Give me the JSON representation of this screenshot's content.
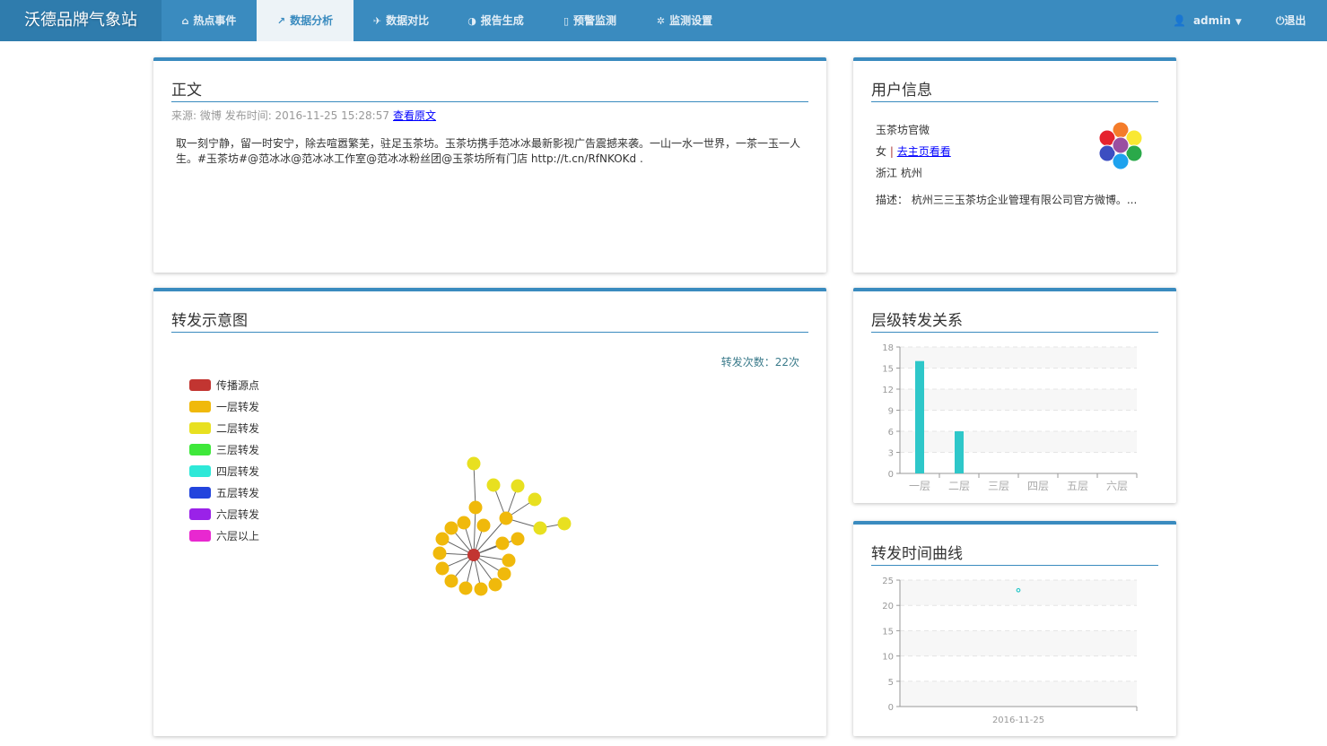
{
  "nav": {
    "brand": "沃德品牌气象站",
    "tabs": [
      {
        "label": "热点事件",
        "icon": "home-icon",
        "glyph": "⌂"
      },
      {
        "label": "数据分析",
        "icon": "line-chart-icon",
        "glyph": "📈"
      },
      {
        "label": "数据对比",
        "icon": "send-icon",
        "glyph": "✈"
      },
      {
        "label": "报告生成",
        "icon": "contrast-icon",
        "glyph": "◑"
      },
      {
        "label": "预警监测",
        "icon": "file-icon",
        "glyph": "▯"
      },
      {
        "label": "监测设置",
        "icon": "gear-icon",
        "glyph": "✲"
      }
    ],
    "active_tab": "数据分析",
    "user": "admin",
    "logout": "退出"
  },
  "article": {
    "title": "正文",
    "source_label": "来源: 微博",
    "time_label": "发布时间: 2016-11-25 15:28:57",
    "view_link": "查看原文",
    "content": "取一刻宁静，留一时安宁，除去喧嚣繁芜，驻足玉茶坊。玉茶坊携手范冰冰最新影视广告震撼来袭。一山一水一世界，一茶一玉一人生。#玉茶坊#@范冰冰@范冰冰工作室@范冰冰粉丝团@玉茶坊所有门店 http://t.cn/RfNKOKd ."
  },
  "user_info": {
    "title": "用户信息",
    "name": "玉茶坊官微",
    "gender": "女",
    "separator": "|",
    "home_link": "去主页看看",
    "location": "浙江 杭州",
    "description": "描述： 杭州三三玉茶坊企业管理有限公司官方微博。..."
  },
  "graph": {
    "title": "转发示意图",
    "count_label": "转发次数：22次",
    "legend": [
      {
        "label": "传播源点",
        "color": "#c23531"
      },
      {
        "label": "一层转发",
        "color": "#f0b90b"
      },
      {
        "label": "二层转发",
        "color": "#e8e020"
      },
      {
        "label": "三层转发",
        "color": "#3ee83a"
      },
      {
        "label": "四层转发",
        "color": "#2ee8d8"
      },
      {
        "label": "五层转发",
        "color": "#2244dd"
      },
      {
        "label": "六层转发",
        "color": "#9a22e8"
      },
      {
        "label": "六层以上",
        "color": "#e828d0"
      }
    ],
    "nodes_level": [
      0,
      1,
      1,
      1,
      1,
      1,
      1,
      1,
      1,
      1,
      1,
      1,
      1,
      1,
      1,
      1,
      1,
      2,
      2,
      2,
      2,
      2,
      2
    ]
  },
  "chart_data": [
    {
      "type": "bar",
      "title": "层级转发关系",
      "categories": [
        "一层",
        "二层",
        "三层",
        "四层",
        "五层",
        "六层"
      ],
      "values": [
        16,
        6,
        0,
        0,
        0,
        0
      ],
      "ylim": [
        0,
        18
      ],
      "yticks": [
        "0",
        "3",
        "6",
        "9",
        "12",
        "15",
        "18"
      ],
      "color": "#2ec7c9"
    },
    {
      "type": "line",
      "title": "转发时间曲线",
      "x": [
        "2016-11-25"
      ],
      "values": [
        23
      ],
      "ylim": [
        0,
        25
      ],
      "yticks": [
        "0",
        "5",
        "10",
        "15",
        "20",
        "25"
      ],
      "color": "#2ec7c9"
    }
  ]
}
